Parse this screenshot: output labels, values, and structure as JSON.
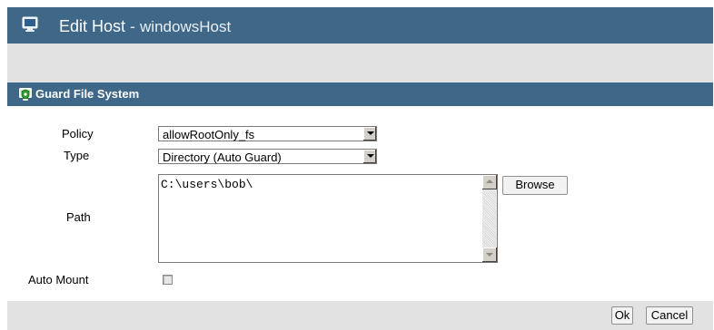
{
  "window": {
    "title_prefix": "Edit Host",
    "title_separator": " - ",
    "title_host": "windowsHost",
    "icon": "monitor-icon"
  },
  "section": {
    "title": "Guard File System",
    "icon": "guard-shield-icon"
  },
  "form": {
    "policy_label": "Policy",
    "policy_value": "allowRootOnly_fs",
    "type_label": "Type",
    "type_value": "Directory (Auto Guard)",
    "path_label": "Path",
    "path_value": "C:\\users\\bob\\",
    "browse_label": "Browse",
    "auto_mount_label": "Auto Mount",
    "auto_mount_checked": false
  },
  "footer": {
    "ok_label": "Ok",
    "cancel_label": "Cancel"
  },
  "colors": {
    "header_bg": "#3f6787",
    "band_bg": "#e2e2e2"
  }
}
